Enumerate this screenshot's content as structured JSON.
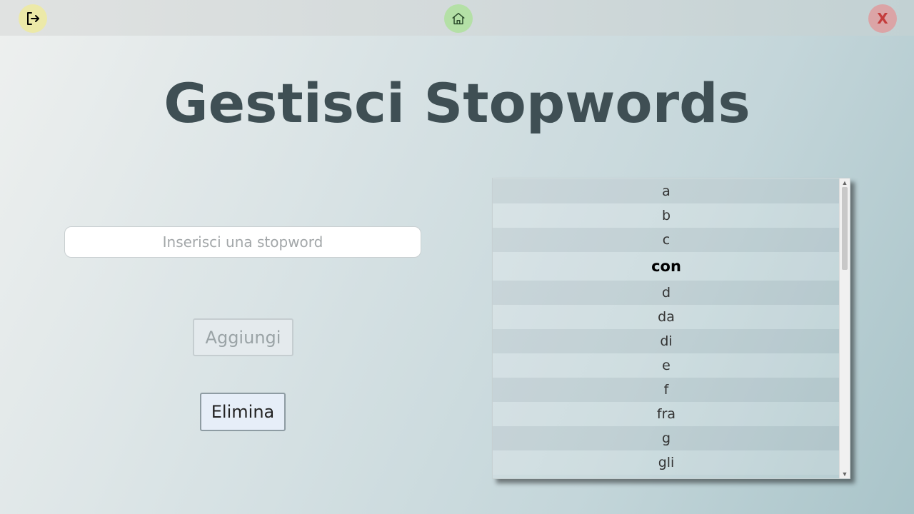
{
  "header": {
    "logout_icon": "logout-icon",
    "home_icon": "home-icon",
    "close_label": "X",
    "colors": {
      "logout": "#ece9a8",
      "home": "#b4e0a6",
      "close": "#dba4a6"
    }
  },
  "main": {
    "title": "Gestisci Stopwords",
    "input_placeholder": "Inserisci una stopword",
    "input_value": "",
    "add_label": "Aggiungi",
    "delete_label": "Elimina"
  },
  "stopwords": {
    "selected": "con",
    "items": [
      "a",
      "b",
      "c",
      "con",
      "d",
      "da",
      "di",
      "e",
      "f",
      "fra",
      "g",
      "gli"
    ]
  }
}
